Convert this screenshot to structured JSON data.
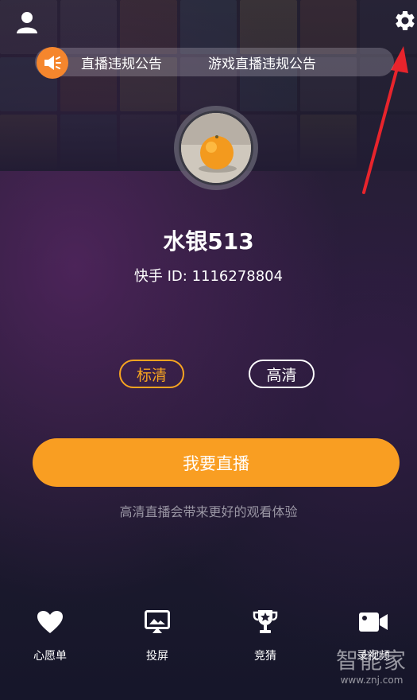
{
  "notice": {
    "items": [
      "直播违规公告",
      "游戏直播违规公告"
    ]
  },
  "profile": {
    "username": "水银513",
    "id_text": "快手 ID: 1116278804"
  },
  "quality": {
    "sd_label": "标清",
    "hd_label": "高清",
    "selected": "标清"
  },
  "main_action": {
    "live_label": "我要直播",
    "hint": "高清直播会带来更好的观看体验"
  },
  "bottom_nav": [
    {
      "label": "心愿单",
      "icon": "heart-icon"
    },
    {
      "label": "投屏",
      "icon": "cast-icon"
    },
    {
      "label": "竞猜",
      "icon": "trophy-icon"
    },
    {
      "label": "录视频",
      "icon": "video-camera-icon"
    }
  ],
  "watermark": {
    "brand": "智能家",
    "url": "www.znj.com"
  },
  "colors": {
    "accent": "#f99e22",
    "selected_outline": "#f7a420",
    "notice_icon": "#f5862d",
    "arrow": "#e8242c"
  }
}
